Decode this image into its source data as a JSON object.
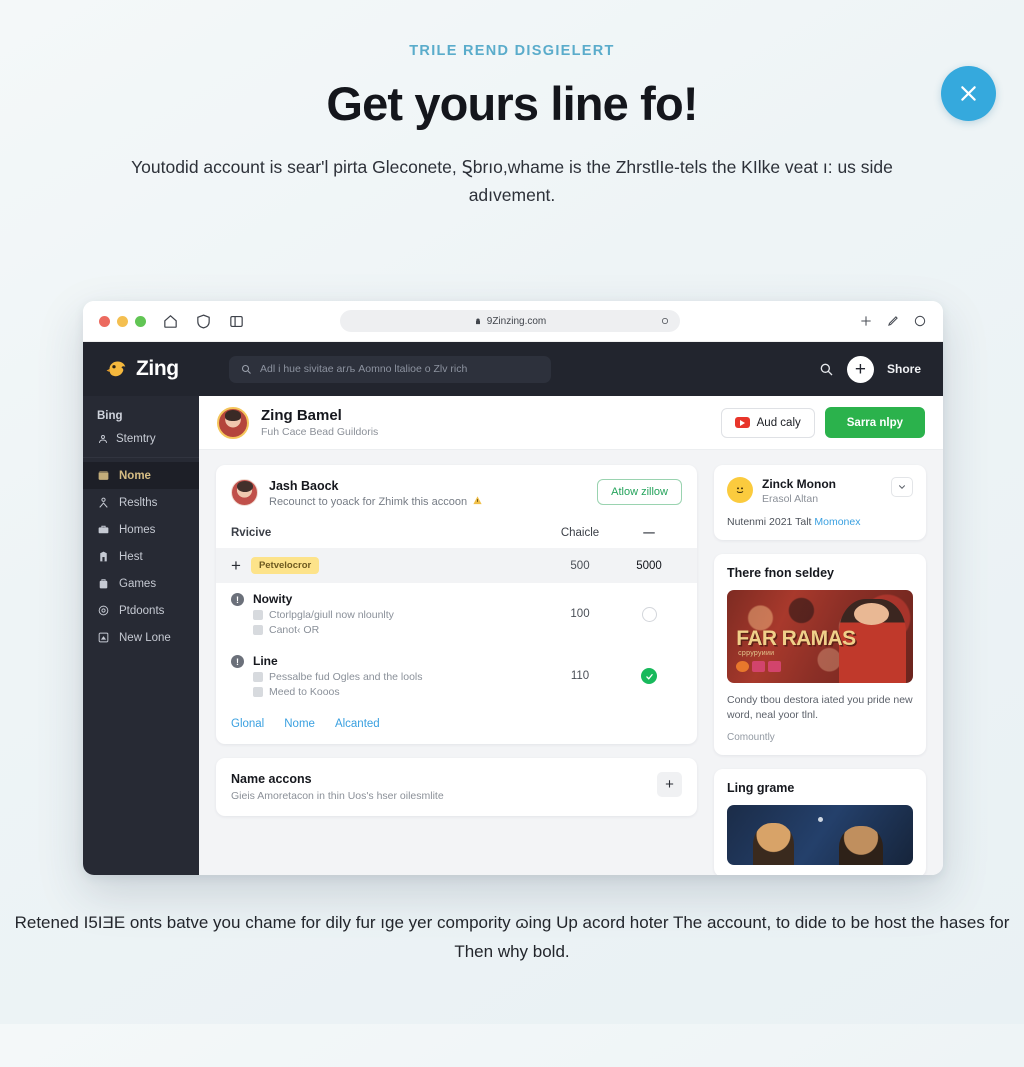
{
  "promo": {
    "eyebrow": "TRILE REND DISGIELERT",
    "headline": "Get yours line fo!",
    "subhead": "Youtodid account is sear'l pirta Gleconete, Ȿbrıo,whame is the ZhrѕtlIe-tels the KІlke veat ı: us side adıvement.",
    "footer": "Retened I5IƎE onts bаtve you chame for dily fur ıge yer comporitу ɷing Up acord hoter The account, to dide to be host the haseѕ for Then why bold.",
    "close_icon": "close-icon",
    "accent_color": "#35a9dd"
  },
  "browser": {
    "url": "9Zinzing.com",
    "traffic_lights": [
      "close",
      "minimize",
      "zoom"
    ],
    "left_icons": [
      "home-icon",
      "shield-icon",
      "sidebar-icon"
    ],
    "right_icons": [
      "extensions-icon",
      "pencil-icon",
      "tabs-icon"
    ],
    "lock_icon": "lock-icon",
    "reload_icon": "reload-icon"
  },
  "appbar": {
    "logo_text": "Zing",
    "logo_icon": "zing-bird-logo",
    "search_placeholder": "Adl i hue sivitae arљ Αomno ltalioe o Zlv rich",
    "search_icon": "search-icon",
    "header_search_icon": "search-icon",
    "plus_label": "+",
    "share_label": "Shore"
  },
  "sidebar": {
    "brand": "Bing",
    "sub_item": {
      "label": "Stemtry",
      "icon": "user-shield-icon"
    },
    "items": [
      {
        "label": "Nome",
        "icon": "inbox-icon",
        "active": true
      },
      {
        "label": "Reslths",
        "icon": "people-icon",
        "active": false
      },
      {
        "label": "Homes",
        "icon": "briefcase-icon",
        "active": false
      },
      {
        "label": "Hest",
        "icon": "building-icon",
        "active": false
      },
      {
        "label": "Games",
        "icon": "bag-icon",
        "active": false
      },
      {
        "label": "Ptdoonts",
        "icon": "target-icon",
        "active": false
      },
      {
        "label": "New Lone",
        "icon": "window-icon",
        "active": false
      }
    ],
    "active_color": "#d6bd84"
  },
  "profile": {
    "name": "Zing Bamel",
    "subtitle": "Fuh Cace Bead Guildoris",
    "avatar": "user-avatar",
    "add_button": {
      "label": "Aud caly",
      "icon": "youtube-icon"
    },
    "primary_button": {
      "label": "Sarra nlpy",
      "color": "#2bb24c"
    }
  },
  "main_card": {
    "channel_name": "Jash Baock",
    "channel_sub": "Recounct to yoack for Zhimk this accoon",
    "warning_icon": "warning-icon",
    "avatar": "user-avatar",
    "allow_button": "Atlow zillow",
    "columns": {
      "c1": "Rvicive",
      "c2": "Chaicle",
      "c3": "—"
    },
    "rows": [
      {
        "kind": "add",
        "icon": "plus-icon",
        "badge": "Petvelocror",
        "value": "500",
        "value2": "5000",
        "highlight": true
      },
      {
        "kind": "item",
        "icon": "clock-icon",
        "title": "Nowity",
        "lines": [
          "Ctorlpgla/giull now nlounlty",
          "Canot‹ OR"
        ],
        "value": "100",
        "status": "empty-circle"
      },
      {
        "kind": "item",
        "icon": "clock-icon",
        "title": "Line",
        "lines": [
          "Pessalbe fud Ogles and the lools",
          "Meed to Kooos"
        ],
        "value": "110",
        "status": "check-circle"
      }
    ],
    "links": [
      "Glonal",
      "Nome",
      "Alcanted"
    ]
  },
  "accounts_card": {
    "title": "Name accons",
    "subtitle": "Gieis Amoretacon in thin Uos's hser oilesmlite",
    "add_icon": "plus-icon"
  },
  "right_cards": {
    "profile": {
      "name": "Zinck Monon",
      "subtitle": "Erasol Altan",
      "emoji": "🙂",
      "meta_prefix": "Nutenmi 2021 Talt ",
      "meta_link": "Momonex",
      "chevron_icon": "chevron-down-icon"
    },
    "feed": {
      "title": "There fnon seldey",
      "thumb_title": "FAR RAMAS",
      "thumb_sub": "срруруиии",
      "caption": "Condy tbou destora iated you pride new word, neal yoor tlnl.",
      "tag": "Comountly",
      "thumb_alt": "sports-team-photo"
    },
    "game": {
      "title": "Ling grame",
      "thumb_alt": "game-thumbnail"
    }
  }
}
